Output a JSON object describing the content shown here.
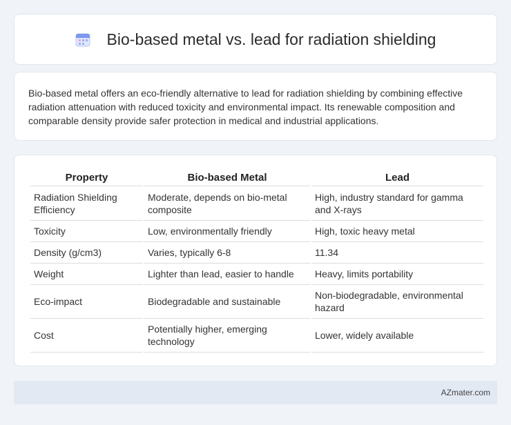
{
  "header": {
    "title": "Bio-based metal vs. lead for radiation shielding",
    "icon": "calendar-icon"
  },
  "intro": {
    "text": "Bio-based metal offers an eco-friendly alternative to lead for radiation shielding by combining effective radiation attenuation with reduced toxicity and environmental impact. Its renewable composition and comparable density provide safer protection in medical and industrial applications."
  },
  "table": {
    "headers": [
      "Property",
      "Bio-based Metal",
      "Lead"
    ],
    "rows": [
      [
        "Radiation Shielding Efficiency",
        "Moderate, depends on bio-metal composite",
        "High, industry standard for gamma and X-rays"
      ],
      [
        "Toxicity",
        "Low, environmentally friendly",
        "High, toxic heavy metal"
      ],
      [
        "Density (g/cm3)",
        "Varies, typically 6-8",
        "11.34"
      ],
      [
        "Weight",
        "Lighter than lead, easier to handle",
        "Heavy, limits portability"
      ],
      [
        "Eco-impact",
        "Biodegradable and sustainable",
        "Non-biodegradable, environmental hazard"
      ],
      [
        "Cost",
        "Potentially higher, emerging technology",
        "Lower, widely available"
      ]
    ]
  },
  "footer": {
    "text": "AZmater.com"
  }
}
